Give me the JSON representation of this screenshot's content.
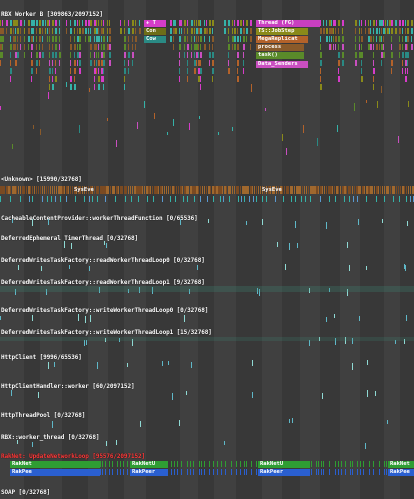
{
  "tracks": {
    "rbx_worker": {
      "label": "RBX Worker B [309863/2097152]"
    },
    "unknown": {
      "label": "<Unknown> [15990/32768]"
    },
    "cacheable": {
      "label": "CacheableContentProvider::workerThreadFunction [0/65536]"
    },
    "deferred_eph": {
      "label": "DeferredEphemeral TimerThread [0/32768]"
    },
    "dwtf_read0": {
      "label": "DeferredWritesTaskFactory::readWorkerThreadLoop0 [0/32768]"
    },
    "dwtf_read1": {
      "label": "DeferredWritesTaskFactory::readWorkerThreadLoop1 [9/32768]"
    },
    "dwtf_write0": {
      "label": "DeferredWritesTaskFactory::writeWorkerThreadLoop0 [0/32768]"
    },
    "dwtf_write1": {
      "label": "DeferredWritesTaskFactory::writeWorkerThreadLoop1 [15/32768]"
    },
    "httpclient": {
      "label": "HttpClient [9996/65536]"
    },
    "httpclienthandler": {
      "label": "HttpClientHandler::worker [60/2097152]"
    },
    "httpthreadpool": {
      "label": "HttpThreadPool [0/32768]"
    },
    "rbx_worker_thread": {
      "label": "RBX::worker_thread [0/32768]"
    },
    "raknet": {
      "label": "RakNet: UpdateNetworkLoop [95576/2097152]"
    },
    "soap": {
      "label": "SOAP [0/32768]"
    }
  },
  "events": {
    "plus_t": "+ T",
    "con": "Con",
    "cow": "Cow",
    "thread_fg": "Thread (FG)",
    "ts_jobstep": "TS::JobStep",
    "megareplicat": "MegaReplicat",
    "process": "process",
    "task": "task()",
    "data_senders": "Data_Senders",
    "syseve_1": "SysEve",
    "syseve_2": "SysEve",
    "raknet_1": "RakNet",
    "raknet_2": "RakNetU",
    "raknet_3": "RakNetU",
    "raknet_4": "RakNet",
    "rakpee_1": "RakPee",
    "rakpee_2": "RakPeer",
    "rakpee_3": "RakPeer",
    "rakpee_4": "RakPee"
  },
  "colors": {
    "background": "#383838",
    "magenta": "#d63cc9",
    "olive": "#8a8a1a",
    "brown": "#8a5a2a",
    "teal": "#35b2a8",
    "green": "#3aa836",
    "blue": "#2a5fd0",
    "label_red": "#ff3b3b"
  }
}
